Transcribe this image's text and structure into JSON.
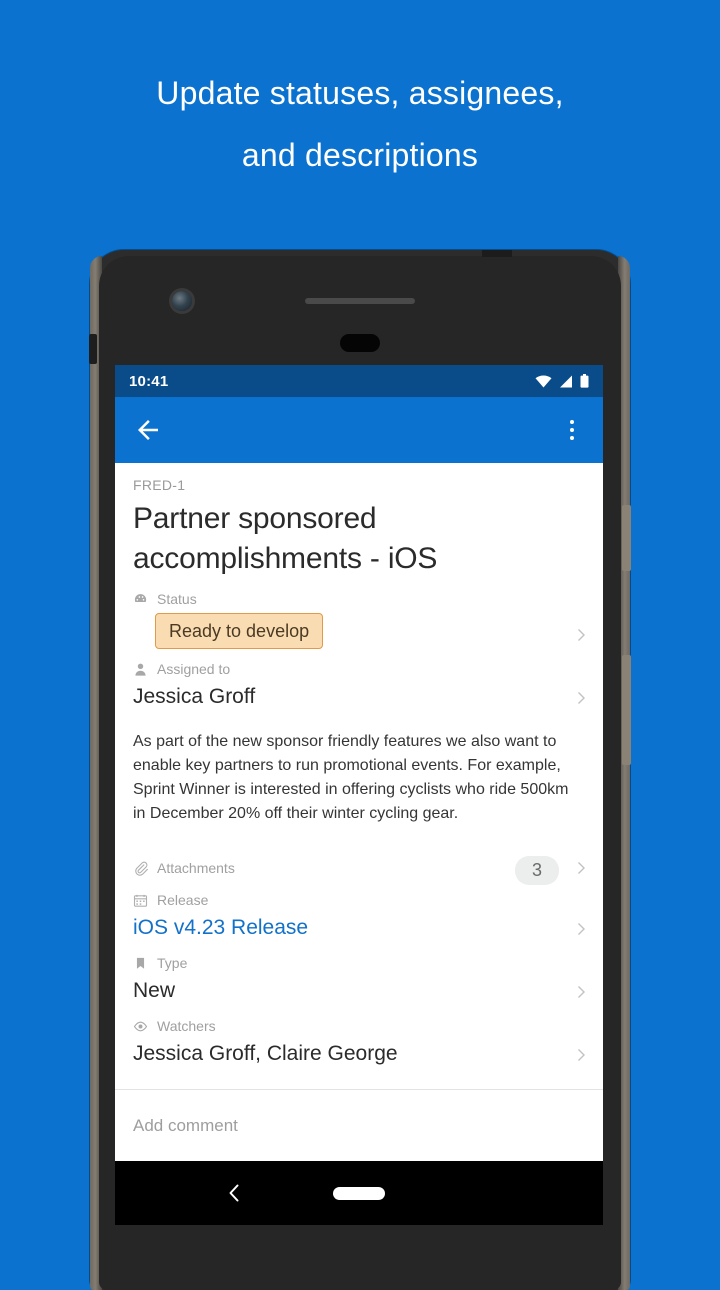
{
  "promo": {
    "line1": "Update statuses, assignees,",
    "line2": "and descriptions",
    "background_color": "#0b72cf",
    "text_color": "#ffffff"
  },
  "phone": {
    "status_bar": {
      "time": "10:41",
      "icons": [
        "wifi-icon",
        "cellular-signal-icon",
        "battery-icon"
      ],
      "background_color": "#0a4b89"
    },
    "app_bar": {
      "back_label": "Back",
      "overflow_label": "More options",
      "background_color": "#0b72cf"
    },
    "nav_bar": {
      "back_label": "Back",
      "home_label": "Home"
    }
  },
  "issue": {
    "key": "FRED-1",
    "title": "Partner sponsored accomplishments - iOS",
    "description": "As part of the new sponsor friendly features we also want to enable key partners to run promotional events. For example, Sprint Winner is interested in offering cyclists who ride 500km in December 20% off their winter cycling gear.",
    "fields": {
      "status": {
        "label": "Status",
        "value": "Ready to develop",
        "icon": "gauge-icon",
        "badge_bg": "#fadcb3",
        "badge_border": "#e09a4a",
        "badge_text_color": "#4a3a23"
      },
      "assignee": {
        "label": "Assigned to",
        "value": "Jessica Groff",
        "icon": "person-icon"
      },
      "attachments": {
        "label": "Attachments",
        "count": "3",
        "icon": "paperclip-icon"
      },
      "release": {
        "label": "Release",
        "value": "iOS v4.23 Release",
        "icon": "calendar-icon",
        "link_color": "#1271c9"
      },
      "type": {
        "label": "Type",
        "value": "New",
        "icon": "bookmark-icon"
      },
      "watchers": {
        "label": "Watchers",
        "value": "Jessica Groff, Claire George",
        "icon": "eye-icon"
      }
    },
    "comment": {
      "placeholder": "Add comment"
    }
  }
}
